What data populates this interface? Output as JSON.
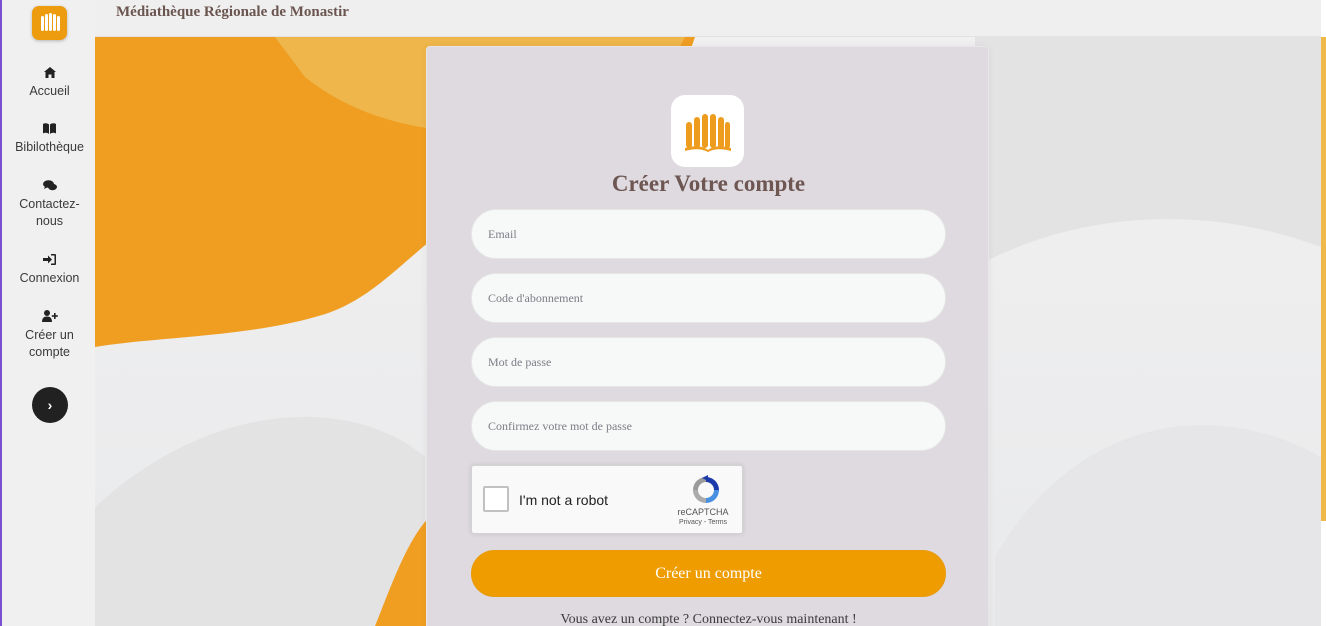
{
  "app": {
    "brand": "Médiathèque Régionale de Monastir"
  },
  "sidebar": {
    "logo_icon": "books-icon",
    "items": [
      {
        "label": "Accueil",
        "icon": "home-icon"
      },
      {
        "label": "Bibilothèque",
        "icon": "book-icon"
      },
      {
        "label": "Contactez-nous",
        "label_lines": [
          "Contactez-",
          "nous"
        ],
        "icon": "comments-icon"
      },
      {
        "label": "Connexion",
        "icon": "sign-in-icon"
      },
      {
        "label": "Créer un compte",
        "label_lines": [
          "Créer un",
          "compte"
        ],
        "icon": "user-plus-icon"
      }
    ],
    "toggle_glyph": "›"
  },
  "form": {
    "title": "Créer Votre compte",
    "email_placeholder": "Email",
    "code_placeholder": "Code d'abonnement",
    "password_placeholder": "Mot de passe",
    "confirm_placeholder": "Confirmez votre mot de passe",
    "captcha": {
      "label": "I'm not a robot",
      "brand": "reCAPTCHA",
      "links": "Privacy - Terms"
    },
    "submit_label": "Créer un compte",
    "login_prompt": "Vous avez un compte ? Connectez-vous maintenant !"
  },
  "colors": {
    "accent": "#ee9c00",
    "sidebar_border": "#7b4fd0",
    "title": "#6e5652"
  }
}
